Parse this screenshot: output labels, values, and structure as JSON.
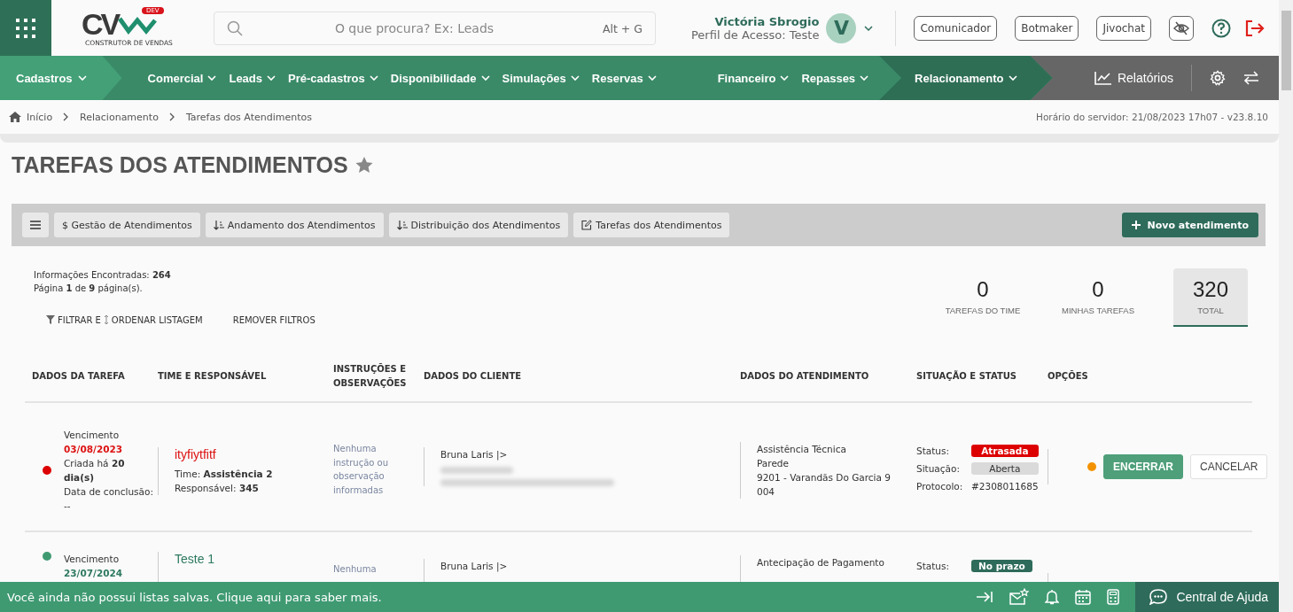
{
  "logo": {
    "letters": "CV",
    "badge": "DEV",
    "tagline": "CONSTRUTOR DE VENDAS"
  },
  "search": {
    "placeholder": "O que procura? Ex: Leads",
    "shortcut": "Alt + G"
  },
  "user": {
    "name": "Victória Sbrogio",
    "profile": "Perfil de Acesso: Teste",
    "initial": "V"
  },
  "header_buttons": [
    "Comunicador",
    "Botmaker",
    "Jivochat"
  ],
  "nav": {
    "primary": "Cadastros",
    "groups": [
      {
        "items": [
          {
            "label": "Comercial",
            "selected": false
          },
          {
            "label": "Leads",
            "selected": false
          },
          {
            "label": "Pré-cadastros",
            "selected": false
          },
          {
            "label": "Disponibilidade",
            "selected": false
          },
          {
            "label": "Simulações",
            "selected": false
          },
          {
            "label": "Reservas",
            "selected": false
          }
        ]
      },
      {
        "items": [
          {
            "label": "Financeiro",
            "selected": false
          },
          {
            "label": "Repasses",
            "selected": false
          },
          {
            "label": "Relacionamento",
            "selected": true
          }
        ]
      }
    ],
    "reports": "Relatórios"
  },
  "breadcrumb": [
    "Início",
    "Relacionamento",
    "Tarefas dos Atendimentos"
  ],
  "server_time": "Horário do servidor: 21/08/2023 17h07 - v23.8.10",
  "title": "TAREFAS DOS ATENDIMENTOS",
  "toolbar": {
    "tabs": [
      "$ Gestão de Atendimentos",
      "Andamento dos Atendimentos",
      "Distribuição dos Atendimentos",
      "Tarefas dos Atendimentos"
    ],
    "new_button": "Novo atendimento"
  },
  "info": [
    "Informações Encontradas: **264**",
    "Página **1** de **9** página(s)."
  ],
  "filter_link": [
    "FILTRAR E",
    "ORDENAR LISTAGEM"
  ],
  "remove_filters": "REMOVER FILTROS",
  "counters": [
    {
      "value": "0",
      "label": "TAREFAS DO TIME",
      "selected": false
    },
    {
      "value": "0",
      "label": "MINHAS TAREFAS",
      "selected": false
    },
    {
      "value": "320",
      "label": "TOTAL",
      "selected": true
    }
  ],
  "table": {
    "columns": [
      "DADOS DA TAREFA",
      "TIME E RESPONSÁVEL",
      "INSTRUÇÕES E OBSERVAÇÕES",
      "DADOS DO CLIENTE",
      "DADOS DO ATENDIMENTO",
      "SITUAÇÃO E STATUS",
      "OPÇÕES"
    ],
    "rows": [
      {
        "late": true,
        "due_label": "Vencimento",
        "due_date": "03/08/2023",
        "created": "Criada há **20 dia(s)**",
        "conclusion": "Data de conclusão: --",
        "task": "ityfiytfitf",
        "team": "Time: **Assistência 2**",
        "owner": "Responsável: **345**",
        "instructions": "Nenhuma instrução ou observação informadas",
        "client": "Bruna Laris |>",
        "service": [
          "Assistência Técnica",
          "Parede",
          "9201 - Varandãs Do Garcia 9 004"
        ],
        "status": [
          {
            "label": "Status:",
            "value": "Atrasada",
            "kind": "late"
          },
          {
            "label": "Situação:",
            "value": "Aberta",
            "kind": "neutral"
          },
          {
            "label": "Protocolo:",
            "value": "#2308011685",
            "kind": "text"
          }
        ],
        "alert": true,
        "actions": [
          "ENCERRAR",
          "CANCELAR"
        ]
      },
      {
        "late": false,
        "due_label": "Vencimento",
        "due_date": "23/07/2024",
        "task": "Teste 1",
        "instructions": "Nenhuma",
        "client": "Bruna Laris |>",
        "service": [
          "Antecipação de Pagamento"
        ],
        "status": [
          {
            "label": "Status:",
            "value": "No prazo",
            "kind": "ontime"
          }
        ]
      }
    ]
  },
  "footer": {
    "message": "Você ainda não possui listas salvas. Clique aqui para saber mais.",
    "help": "Central de Ajuda"
  }
}
